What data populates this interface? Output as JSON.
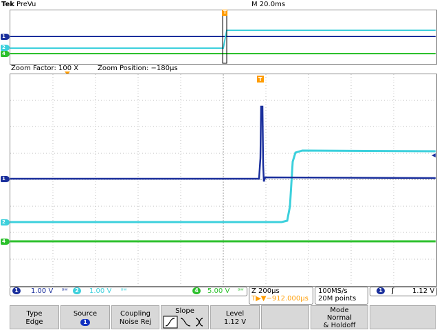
{
  "header": {
    "brand": "Tek",
    "mode": "PreVu",
    "timebase": "M 20.0ms"
  },
  "zoom": {
    "factor_label": "Zoom Factor: 100 X",
    "position_label": "Zoom Position: −180µs"
  },
  "trigger_marker": "T",
  "channels": {
    "ch1": {
      "num": "1",
      "color": "#1a2f9c"
    },
    "ch2": {
      "num": "2",
      "color": "#3cd0dc"
    },
    "ch4": {
      "num": "4",
      "color": "#2cc02c"
    }
  },
  "readouts": {
    "ch1_scale": "1.00 V",
    "ch2_scale": "1.00 V",
    "ch4_scale": "5.00 V",
    "bw_symbol": "ᴮᵂ",
    "zoom_time": "Z 200µs",
    "trigger_pos": "T▶▼−912.000µs",
    "sample_rate": "100MS/s",
    "record_length": "20M points",
    "trig_source": "1",
    "trig_level": "1.12 V",
    "trig_slope_symbol": "ʃ"
  },
  "menu": {
    "type_label": "Type",
    "type_value": "Edge",
    "source_label": "Source",
    "source_value": "1",
    "coupling_label": "Coupling",
    "coupling_value": "Noise Rej",
    "slope_label": "Slope",
    "level_label": "Level",
    "level_value": "1.12 V",
    "mode_label": "Mode",
    "mode_value1": "Normal",
    "mode_value2": "& Holdoff"
  }
}
